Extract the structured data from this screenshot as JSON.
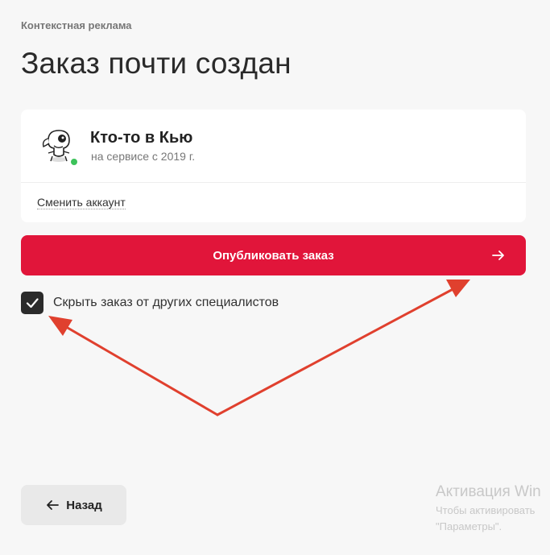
{
  "breadcrumb": "Контекстная реклама",
  "title": "Заказ почти создан",
  "account": {
    "name": "Кто-то в Кью",
    "since": "на сервисе с 2019 г.",
    "switch_label": "Сменить аккаунт",
    "status": "online",
    "status_color": "#3cc25a"
  },
  "publish_button": {
    "label": "Опубликовать заказ",
    "icon": "arrow-right-icon"
  },
  "hide_option": {
    "label": "Скрыть заказ от других специалистов",
    "checked": true
  },
  "back_button": {
    "label": "Назад",
    "icon": "arrow-left-icon"
  },
  "watermark": {
    "title": "Активация Win",
    "line1": "Чтобы активировать",
    "line2": "\"Параметры\"."
  },
  "colors": {
    "accent": "#e1153a",
    "annotation_arrow": "#e0402e"
  }
}
